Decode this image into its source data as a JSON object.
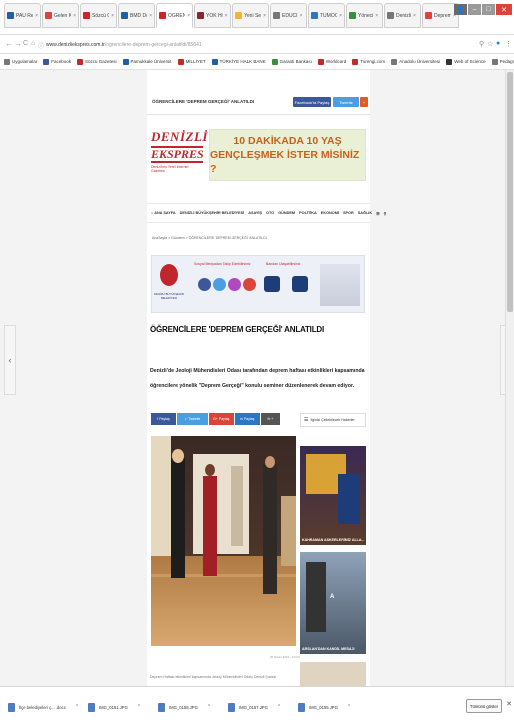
{
  "browser": {
    "tabs": [
      {
        "label": "PAÜ Ref.",
        "color": "#1e5fa8"
      },
      {
        "label": "Gelen K",
        "color": "#d9453b"
      },
      {
        "label": "Sözcü G",
        "color": "#c62828"
      },
      {
        "label": "BMD Do",
        "color": "#1e5fa8"
      },
      {
        "label": "ÖĞRENC",
        "color": "#c62828",
        "active": true
      },
      {
        "label": "YÖK Hi",
        "color": "#8e2430"
      },
      {
        "label": "Yeni Sek",
        "color": "#f2b632"
      },
      {
        "label": "EDUCI",
        "color": "#777777"
      },
      {
        "label": "TÜMOC",
        "color": "#2a77c4"
      },
      {
        "label": "Yöneci",
        "color": "#3a8f3a"
      },
      {
        "label": "Denizli",
        "color": "#777777"
      },
      {
        "label": "Deprem",
        "color": "#d9453b"
      }
    ],
    "window_controls": {
      "user": "👤",
      "minimize": "–",
      "maximize": "□",
      "close": "✕"
    },
    "url_host": "www.denizliekspres.com.tr",
    "url_path": "/ogrencilere-deprem-gercegi-anlatildi/85641",
    "nav": {
      "back": "←",
      "forward": "→",
      "reload": "C",
      "home": "⌂",
      "lock": "ⓘ"
    },
    "addr_icons": {
      "key": "⚲",
      "star": "☆",
      "ext": "●",
      "menu": "⋮"
    },
    "bookmarks": [
      {
        "label": "Uygulamalar",
        "color": "#777777"
      },
      {
        "label": "Facebook",
        "color": "#3b5998"
      },
      {
        "label": "Sözcü Gazetesi",
        "color": "#c62828"
      },
      {
        "label": "Pamukkale Üniversit",
        "color": "#1e5fa8"
      },
      {
        "label": "MİLLİYET",
        "color": "#c62828"
      },
      {
        "label": "TÜRKİYE HALK BANK",
        "color": "#1e5fa8"
      },
      {
        "label": "Garanti Bankası",
        "color": "#3a8f3a"
      },
      {
        "label": "Worldcard",
        "color": "#c62828"
      },
      {
        "label": "Turengi.com",
        "color": "#c62828"
      },
      {
        "label": "Anadolu Üniversitesi",
        "color": "#777777"
      },
      {
        "label": "Web of Science",
        "color": "#333333"
      },
      {
        "label": "Pedagnesis of Ci-ıl",
        "color": "#777777"
      }
    ],
    "bookmark_more": "»"
  },
  "page": {
    "top_title": "ÖĞRENCİLERE 'DEPREM GERÇEĞİ' ANLATILDI",
    "share_fb": "Facebook'ta Paylaş",
    "share_tw": "Tweetle",
    "share_plus": "+",
    "logo_line1": "DENİZLİ",
    "logo_line2": "EKSPRES",
    "logo_tagline": "Denizli'nin Yerel İnternet Gazetesi",
    "banner_line1": "10 DAKİKADA 10 YAŞ",
    "banner_line2": "GENÇLEŞMEK İSTER MİSİNİZ ?",
    "nav_items": [
      "⌂ ANA SAYFA",
      "DENİZLİ BÜYÜKŞEHİR BELEDİYESİ",
      "ASAYİŞ",
      "OTO",
      "GÜNDEM",
      "POLİTİKA",
      "EKONOMİ",
      "SPOR",
      "SAĞLIK",
      "☰",
      "⚲"
    ],
    "breadcrumb": "AnaSayfa > Gündem > ÖĞRENCİLERE 'DEPREM GERÇEĞİ' ANLATILDI",
    "ad_text1": "Sosyal Medyadan Takip Edebilirsiniz",
    "ad_text2": "Bandan Ulaşabilirsiniz",
    "ad_org": "DENİZLİ BÜYÜKŞEHİR BELEDİYESİ",
    "headline": "ÖĞRENCİLERE 'DEPREM GERÇEĞİ' ANLATILDI",
    "lead": "Denizli'de Jeoloji Mühendisleri Odası tarafından deprem haftası etkinlikleri kapsamında öğrencilere yönelik \"Deprem Gerçeği\" konulu seminer düzenlenerek devam ediyor.",
    "share_buttons": [
      {
        "label": "f Paylaş",
        "color": "#3b5998"
      },
      {
        "label": "✓ Tweetle",
        "color": "#4a9fe0"
      },
      {
        "label": "G+ Paylaş",
        "color": "#d9453b"
      },
      {
        "label": "in Paylaş",
        "color": "#2a77c4"
      },
      {
        "label": "✉ +",
        "color": "#555555"
      }
    ],
    "related_title": "İlginizi Çekebilecek Haberler",
    "photo_caption": "30 Nisan 2019 - 10:20",
    "body_snippet": "Deprem Haftası etkinlikleri kapsamında Jeoloji Mühendisleri Odası Denizli Şubesi",
    "side_cards": [
      {
        "caption": "KAHRAMAN ASKERLERİMİZ ALLA..."
      },
      {
        "caption": "ARSLAN'DAN KANDİL MESAJI"
      }
    ]
  },
  "downloads": {
    "items": [
      {
        "name": "İlçe belediyeleri ç... .docx"
      },
      {
        "name": "IMG_0161.JPG"
      },
      {
        "name": "IMG_0158.JPG"
      },
      {
        "name": "IMG_0157.JPG"
      },
      {
        "name": "IMG_0155.JPG"
      }
    ],
    "caret": "^",
    "show_all": "Tümünü göster",
    "close": "✕"
  },
  "side_arrows": {
    "left": "‹",
    "right": "›"
  }
}
